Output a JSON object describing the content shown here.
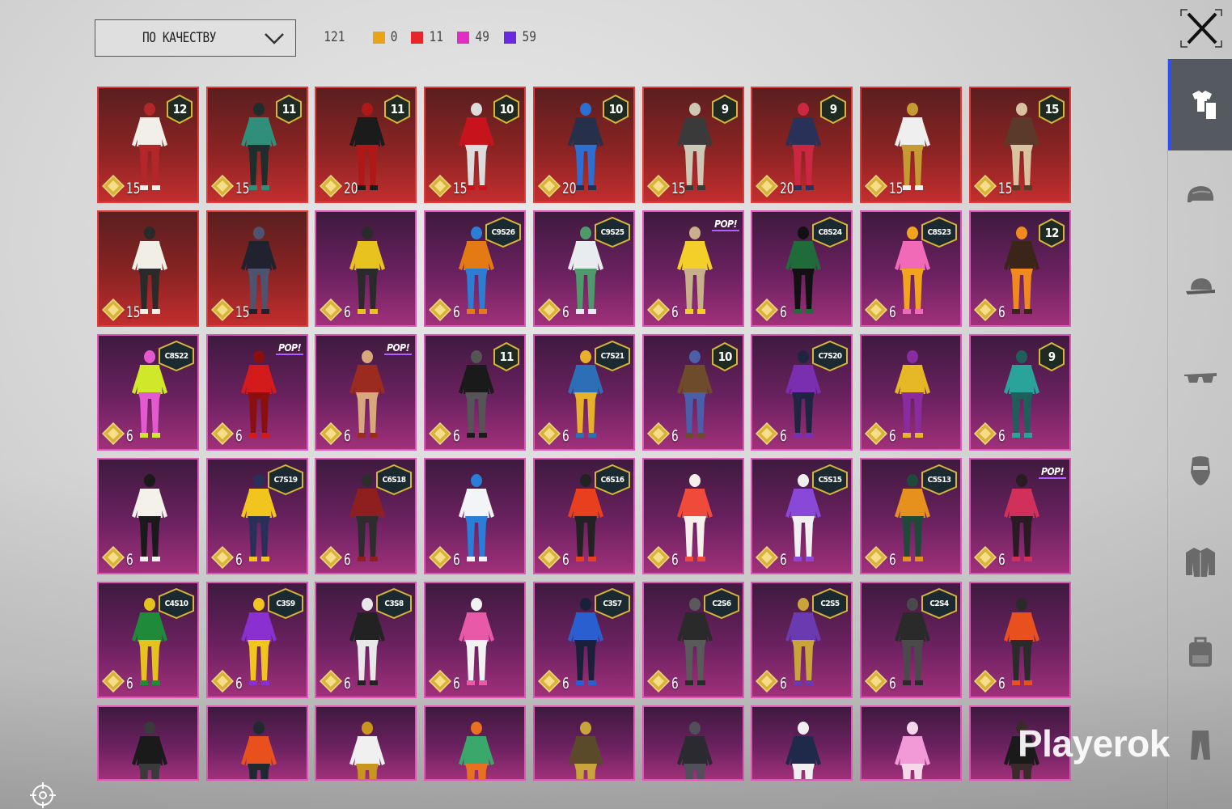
{
  "sort": {
    "label": "ПО КАЧЕСТВУ"
  },
  "stats": {
    "total": "121",
    "counts": [
      {
        "color": "#e8a317",
        "value": "0"
      },
      {
        "color": "#e8262a",
        "value": "11"
      },
      {
        "color": "#e12dc4",
        "value": "49"
      },
      {
        "color": "#6a28e0",
        "value": "59"
      }
    ]
  },
  "watermark": "Playerok",
  "sidebar": [
    {
      "name": "outfit-tab",
      "icon": "shirt-pants-icon",
      "active": true
    },
    {
      "name": "helmet-tab",
      "icon": "helmet-icon",
      "active": false
    },
    {
      "name": "hat-tab",
      "icon": "cap-icon",
      "active": false
    },
    {
      "name": "glasses-tab",
      "icon": "glasses-icon",
      "active": false
    },
    {
      "name": "mask-tab",
      "icon": "mask-icon",
      "active": false
    },
    {
      "name": "jacket-tab",
      "icon": "jacket-icon",
      "active": false
    },
    {
      "name": "backpack-tab",
      "icon": "backpack-icon",
      "active": false
    },
    {
      "name": "pants-tab",
      "icon": "pants-icon",
      "active": false
    }
  ],
  "items": [
    {
      "rarity": "red",
      "badge": "12",
      "price": "15",
      "palette": [
        "#f2efe8",
        "#b3262a"
      ]
    },
    {
      "rarity": "red",
      "badge": "11",
      "price": "15",
      "palette": [
        "#2f8f7a",
        "#1d2e2c"
      ]
    },
    {
      "rarity": "red",
      "badge": "11",
      "price": "20",
      "palette": [
        "#1b1b1b",
        "#b01818"
      ]
    },
    {
      "rarity": "red",
      "badge": "10",
      "price": "15",
      "palette": [
        "#c7141c",
        "#dcdcdc"
      ]
    },
    {
      "rarity": "red",
      "badge": "10",
      "price": "20",
      "palette": [
        "#27304a",
        "#2c6fd0"
      ]
    },
    {
      "rarity": "red",
      "badge": "9",
      "price": "15",
      "palette": [
        "#3a3a3a",
        "#cfc7b5"
      ]
    },
    {
      "rarity": "red",
      "badge": "9",
      "price": "20",
      "palette": [
        "#2a3158",
        "#cc2740"
      ]
    },
    {
      "rarity": "red",
      "badge": "",
      "price": "15",
      "palette": [
        "#efefef",
        "#c69a33"
      ]
    },
    {
      "rarity": "red",
      "badge": "15",
      "price": "15",
      "palette": [
        "#5c3a2a",
        "#d8c2a0"
      ]
    },
    {
      "rarity": "red",
      "badge": "",
      "price": "15",
      "palette": [
        "#f1eee6",
        "#2a2a2a"
      ]
    },
    {
      "rarity": "red",
      "badge": "",
      "price": "15",
      "palette": [
        "#202230",
        "#4e5470"
      ]
    },
    {
      "rarity": "purple",
      "badge": "",
      "price": "6",
      "palette": [
        "#e8c21e",
        "#2a2a2a"
      ]
    },
    {
      "rarity": "purple",
      "season": "C9S26",
      "price": "6",
      "palette": [
        "#e47a14",
        "#2d7dd2"
      ]
    },
    {
      "rarity": "purple",
      "season": "C9S25",
      "price": "6",
      "palette": [
        "#e9ecef",
        "#4f9a6b"
      ]
    },
    {
      "rarity": "purple",
      "pop": "POP!",
      "price": "6",
      "palette": [
        "#f4cf2a",
        "#c8b08a"
      ]
    },
    {
      "rarity": "purple",
      "season": "C8S24",
      "price": "6",
      "palette": [
        "#1f6b3a",
        "#111111"
      ]
    },
    {
      "rarity": "purple",
      "season": "C8S23",
      "price": "6",
      "palette": [
        "#f06ab8",
        "#f2a51c"
      ]
    },
    {
      "rarity": "purple",
      "badge": "12",
      "price": "6",
      "palette": [
        "#3b2418",
        "#f08a1c"
      ]
    },
    {
      "rarity": "purple",
      "season": "C8S22",
      "price": "6",
      "palette": [
        "#cfe82a",
        "#e35ad0"
      ]
    },
    {
      "rarity": "purple",
      "pop": "POP!",
      "price": "6",
      "palette": [
        "#d41b1b",
        "#8a1010"
      ]
    },
    {
      "rarity": "purple",
      "pop": "POP!",
      "price": "6",
      "palette": [
        "#9b2b1e",
        "#d8a77c"
      ]
    },
    {
      "rarity": "purple",
      "badge": "11",
      "price": "6",
      "palette": [
        "#1a1a1a",
        "#555555"
      ]
    },
    {
      "rarity": "purple",
      "season": "C7S21",
      "price": "6",
      "palette": [
        "#2d6fb7",
        "#e6b02a"
      ]
    },
    {
      "rarity": "purple",
      "badge": "10",
      "price": "6",
      "palette": [
        "#6e4b2a",
        "#4a5fa8"
      ]
    },
    {
      "rarity": "purple",
      "season": "C7S20",
      "price": "6",
      "palette": [
        "#7a2fb0",
        "#1d2540"
      ]
    },
    {
      "rarity": "purple",
      "badge": "",
      "price": "6",
      "palette": [
        "#e6b826",
        "#8a2ca0"
      ]
    },
    {
      "rarity": "purple",
      "badge": "9",
      "price": "6",
      "palette": [
        "#2aa39a",
        "#1f5f5a"
      ]
    },
    {
      "rarity": "purple",
      "badge": "",
      "price": "6",
      "palette": [
        "#f3f1ea",
        "#1a1a1a"
      ]
    },
    {
      "rarity": "purple",
      "season": "C7S19",
      "price": "6",
      "palette": [
        "#f2c51e",
        "#28305a"
      ]
    },
    {
      "rarity": "purple",
      "season": "C6S18",
      "price": "6",
      "palette": [
        "#8f1f1f",
        "#2d2d2d"
      ]
    },
    {
      "rarity": "purple",
      "badge": "",
      "price": "6",
      "palette": [
        "#f2f4f8",
        "#2a7ed8"
      ]
    },
    {
      "rarity": "purple",
      "season": "C6S16",
      "price": "6",
      "palette": [
        "#e8401e",
        "#222222"
      ]
    },
    {
      "rarity": "purple",
      "badge": "",
      "price": "6",
      "palette": [
        "#ef4a3a",
        "#f5f1ea"
      ]
    },
    {
      "rarity": "purple",
      "season": "C5S15",
      "price": "6",
      "palette": [
        "#8a48d8",
        "#f0f0f0"
      ]
    },
    {
      "rarity": "purple",
      "season": "C5S13",
      "price": "6",
      "palette": [
        "#e6901e",
        "#1f4a3a"
      ]
    },
    {
      "rarity": "purple",
      "pop": "POP!",
      "price": "6",
      "palette": [
        "#d0305a",
        "#2a1a22"
      ]
    },
    {
      "rarity": "purple",
      "season": "C4S10",
      "price": "6",
      "palette": [
        "#1f8a3a",
        "#e6c21e"
      ]
    },
    {
      "rarity": "purple",
      "season": "C3S9",
      "price": "6",
      "palette": [
        "#8a2fd0",
        "#f2c51e"
      ]
    },
    {
      "rarity": "purple",
      "season": "C3S8",
      "price": "6",
      "palette": [
        "#222222",
        "#e8e8e8"
      ]
    },
    {
      "rarity": "purple",
      "badge": "",
      "price": "6",
      "palette": [
        "#e85aa8",
        "#f2f2f2"
      ]
    },
    {
      "rarity": "purple",
      "season": "C3S7",
      "price": "6",
      "palette": [
        "#2a5fd0",
        "#1a1f3a"
      ]
    },
    {
      "rarity": "purple",
      "season": "C2S6",
      "price": "6",
      "palette": [
        "#2a2a2a",
        "#5a5a5a"
      ]
    },
    {
      "rarity": "purple",
      "season": "C2S5",
      "price": "6",
      "palette": [
        "#6a3ab0",
        "#c9a43a"
      ]
    },
    {
      "rarity": "purple",
      "season": "C2S4",
      "price": "6",
      "palette": [
        "#2a2a2a",
        "#4a4a4a"
      ]
    },
    {
      "rarity": "purple",
      "badge": "",
      "price": "6",
      "palette": [
        "#e8501e",
        "#2a2a2a"
      ]
    },
    {
      "rarity": "purple",
      "badge": "",
      "price": "",
      "palette": [
        "#1a1a1a",
        "#3a3a3a"
      ]
    },
    {
      "rarity": "purple",
      "badge": "",
      "price": "",
      "palette": [
        "#e8501e",
        "#1f2a30"
      ]
    },
    {
      "rarity": "purple",
      "badge": "",
      "price": "",
      "palette": [
        "#f0f0f0",
        "#c8961e"
      ]
    },
    {
      "rarity": "purple",
      "badge": "",
      "price": "",
      "palette": [
        "#3aa86a",
        "#e8701e"
      ]
    },
    {
      "rarity": "purple",
      "badge": "",
      "price": "",
      "palette": [
        "#5a4a2a",
        "#c9a43a"
      ]
    },
    {
      "rarity": "purple",
      "badge": "",
      "price": "",
      "palette": [
        "#2a2a30",
        "#50505a"
      ]
    },
    {
      "rarity": "purple",
      "badge": "",
      "price": "",
      "palette": [
        "#1f2a4a",
        "#f0f0f0"
      ]
    },
    {
      "rarity": "purple",
      "badge": "",
      "price": "",
      "palette": [
        "#f29ad8",
        "#f5d8ea"
      ]
    },
    {
      "rarity": "purple",
      "badge": "",
      "price": "",
      "palette": [
        "#1a1a1a",
        "#3a2a2a"
      ]
    }
  ]
}
